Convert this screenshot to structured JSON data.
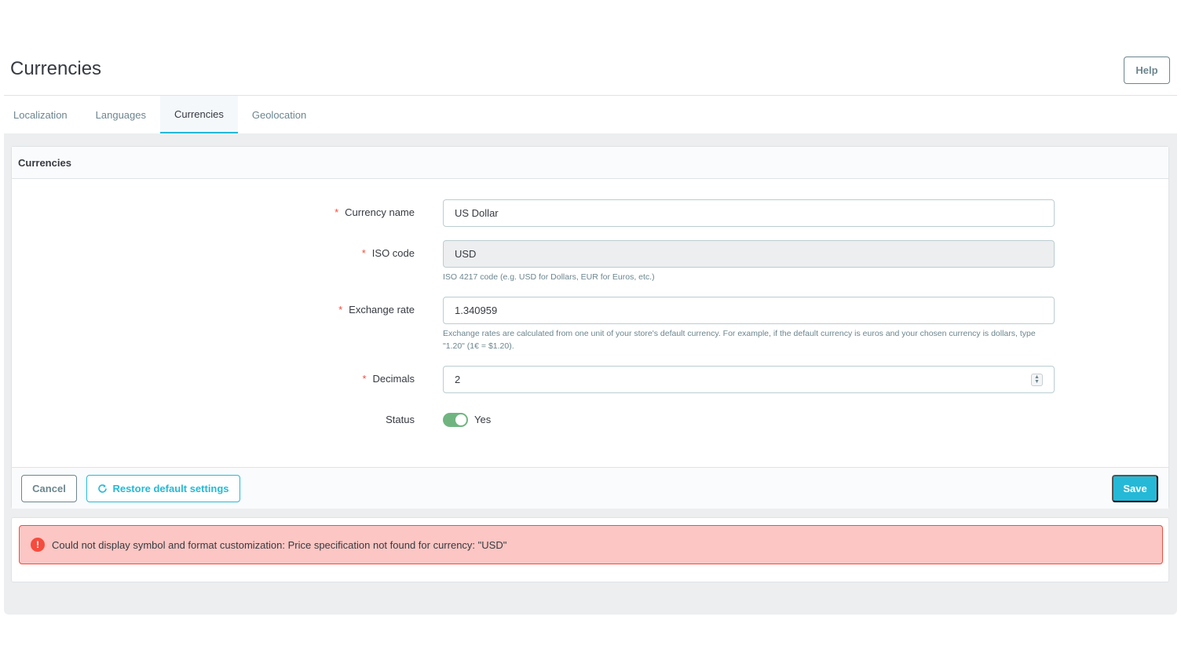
{
  "page": {
    "title": "Currencies",
    "help_label": "Help"
  },
  "tabs": [
    {
      "label": "Localization",
      "active": false
    },
    {
      "label": "Languages",
      "active": false
    },
    {
      "label": "Currencies",
      "active": true
    },
    {
      "label": "Geolocation",
      "active": false
    }
  ],
  "card": {
    "title": "Currencies",
    "required_mark": "*",
    "fields": {
      "currency_name": {
        "label": "Currency name",
        "value": "US Dollar"
      },
      "iso_code": {
        "label": "ISO code",
        "value": "USD",
        "hint": "ISO 4217 code (e.g. USD for Dollars, EUR for Euros, etc.)"
      },
      "exchange_rate": {
        "label": "Exchange rate",
        "value": "1.340959",
        "hint": "Exchange rates are calculated from one unit of your store's default currency. For example, if the default currency is euros and your chosen currency is dollars, type \"1.20\" (1€ = $1.20)."
      },
      "decimals": {
        "label": "Decimals",
        "value": "2"
      },
      "status": {
        "label": "Status",
        "value_label": "Yes",
        "enabled": true
      }
    },
    "footer": {
      "cancel_label": "Cancel",
      "restore_label": "Restore default settings",
      "save_label": "Save"
    }
  },
  "alert": {
    "icon": "!",
    "message": "Could not display symbol and format customization: Price specification not found for currency: \"USD\""
  },
  "colors": {
    "accent": "#25b9d7",
    "toggle_on": "#70b580",
    "error_bg": "#fbc6c3",
    "error_border": "#f54c3e"
  }
}
